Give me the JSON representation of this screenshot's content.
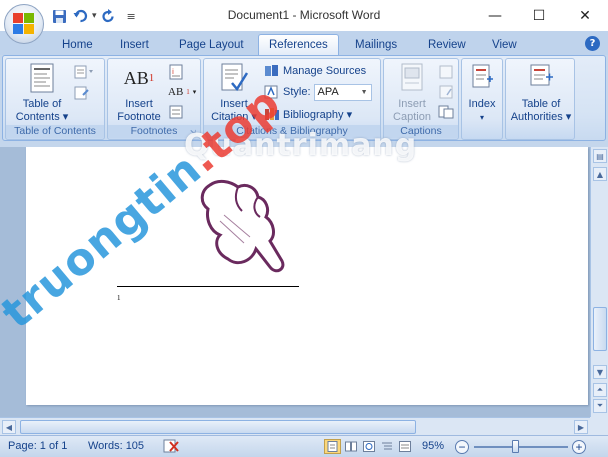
{
  "window": {
    "title": "Document1 - Microsoft Word",
    "minimize_glyph": "—",
    "maximize_glyph": "☐",
    "close_glyph": "✕"
  },
  "qat": {
    "icons": [
      "save-icon",
      "undo-icon",
      "redo-icon",
      "customize-icon"
    ],
    "separator_glyph": "▾",
    "more_glyph": "≡"
  },
  "tabs": [
    {
      "label": "Home"
    },
    {
      "label": "Insert"
    },
    {
      "label": "Page Layout"
    },
    {
      "label": "References"
    },
    {
      "label": "Mailings"
    },
    {
      "label": "Review"
    },
    {
      "label": "View"
    }
  ],
  "active_tab": "References",
  "help_glyph": "?",
  "ribbon": {
    "toc": {
      "group_label": "Table of Contents",
      "button_line1": "Table of",
      "button_line2": "Contents ▾"
    },
    "footnotes": {
      "group_label": "Footnotes",
      "button_line1": "Insert",
      "button_line2": "Footnote",
      "icon_text": "AB",
      "icon_sup": "1",
      "next_text": "AB",
      "next_sup": "1"
    },
    "citations": {
      "group_label": "Citations & Bibliography",
      "insert_line1": "Insert",
      "insert_line2": "Citation ▾",
      "manage_sources": "Manage Sources",
      "style_label": "Style:",
      "style_value": "APA",
      "bibliography": "Bibliography ▾"
    },
    "captions": {
      "group_label": "Captions",
      "button_line1": "Insert",
      "button_line2": "Caption"
    },
    "index": {
      "group_label": "",
      "button_line1": "Index",
      "button_line2": "▾"
    },
    "authorities": {
      "group_label": "",
      "button_line1": "Table of",
      "button_line2": "Authorities ▾"
    }
  },
  "document": {
    "footnote_number": "1"
  },
  "watermarks": {
    "top": "Quantrimang",
    "diagonal_main": "truongtin",
    "diagonal_tail": ".top"
  },
  "statusbar": {
    "page": "Page: 1 of 1",
    "words": "Words: 105",
    "zoom": "95%",
    "zoom_out": "−",
    "zoom_in": "+"
  },
  "colors": {
    "accent": "#15428b",
    "ribbon_bg": "#dce7f6",
    "page_bg": "#ffffff",
    "hand_stroke": "#6a2a5e"
  }
}
